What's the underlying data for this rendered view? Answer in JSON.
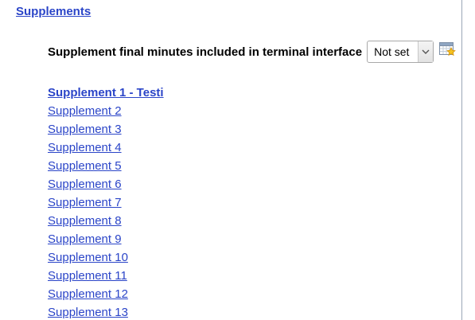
{
  "section": {
    "title": "Supplements"
  },
  "setting": {
    "label": "Supplement final minutes included in terminal interface",
    "selected_value": "Not set",
    "icon": "calendar-star-icon"
  },
  "supplements": [
    "Supplement 1 - Testi",
    "Supplement 2",
    "Supplement 3",
    "Supplement 4",
    "Supplement 5",
    "Supplement 6",
    "Supplement 7",
    "Supplement 8",
    "Supplement 9",
    "Supplement 10",
    "Supplement 11",
    "Supplement 12",
    "Supplement 13"
  ],
  "colors": {
    "link": "#2b45c8",
    "border": "#9aa7b6"
  }
}
